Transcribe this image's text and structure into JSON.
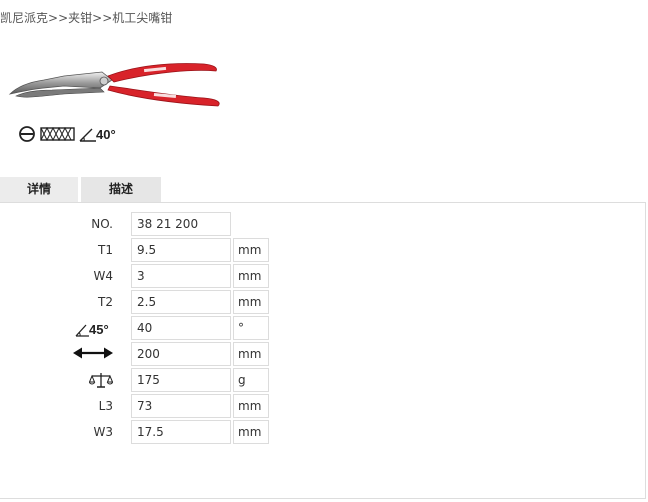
{
  "breadcrumb": {
    "items": [
      "凯尼派克",
      "夹钳",
      "机工尖嘴钳"
    ],
    "separator": ">>"
  },
  "product": {
    "image_icon": "bent-nose-pliers-icon",
    "handle_color": "#d8232a",
    "feature_icons": [
      "slotted-screw-icon",
      "serrated-jaw-icon",
      "angle-icon"
    ],
    "feature_angle_label": "40°"
  },
  "tabs": [
    {
      "label": "详情",
      "active": true
    },
    {
      "label": "描述",
      "active": false
    }
  ],
  "specs": [
    {
      "label": "NO.",
      "value": "38 21 200",
      "unit": null
    },
    {
      "label": "T1",
      "value": "9.5",
      "unit": "mm"
    },
    {
      "label": "W4",
      "value": "3",
      "unit": "mm"
    },
    {
      "label": "T2",
      "value": "2.5",
      "unit": "mm"
    },
    {
      "label": "45°",
      "icon": "angle-icon",
      "value": "40",
      "unit": "°"
    },
    {
      "label": "",
      "icon": "length-arrow-icon",
      "value": "200",
      "unit": "mm"
    },
    {
      "label": "",
      "icon": "weight-scale-icon",
      "value": "175",
      "unit": "g"
    },
    {
      "label": "L3",
      "value": "73",
      "unit": "mm"
    },
    {
      "label": "W3",
      "value": "17.5",
      "unit": "mm"
    }
  ]
}
